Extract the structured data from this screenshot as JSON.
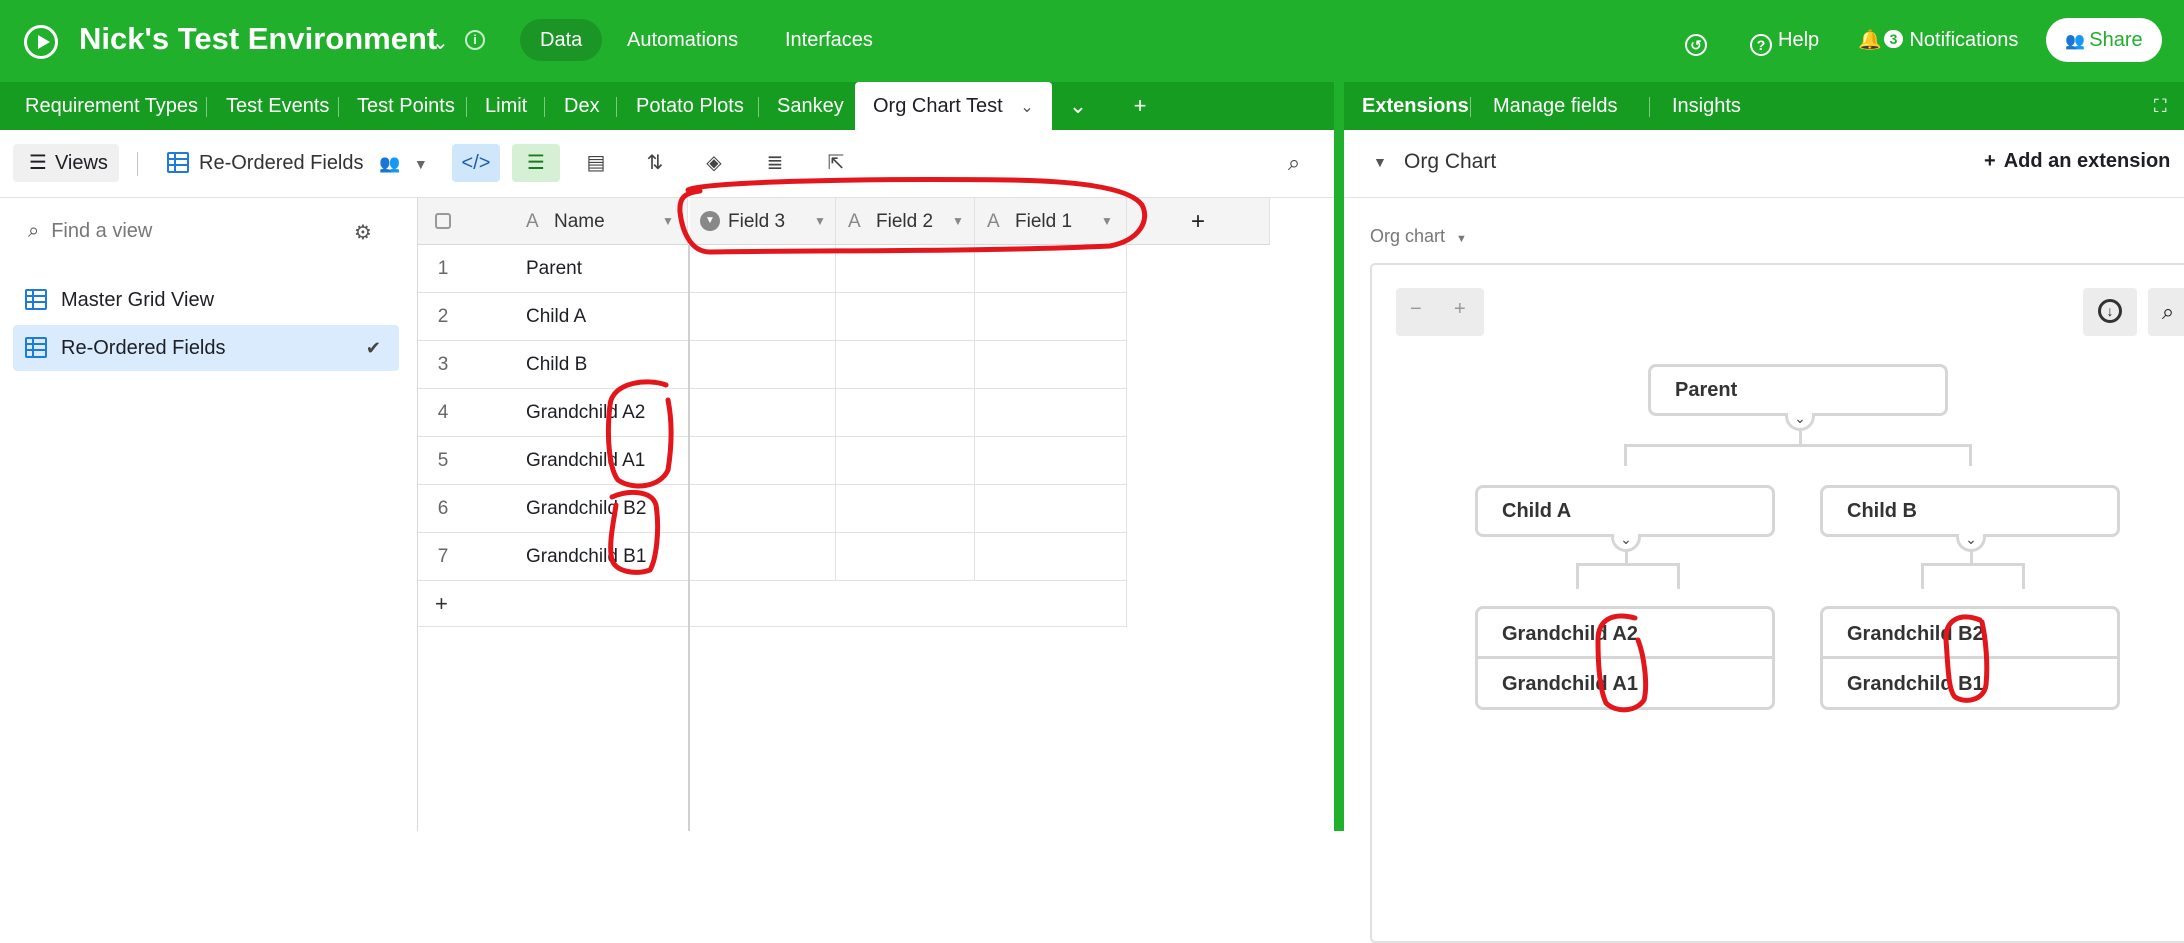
{
  "topbar": {
    "title": "Nick's Test Environment",
    "nav": [
      "Data",
      "Automations",
      "Interfaces"
    ],
    "help": "Help",
    "notifications": "Notifications",
    "notification_count": "3",
    "share": "Share"
  },
  "tabs": [
    "Requirement Types",
    "Test Events",
    "Test Points",
    "Limit",
    "Dex",
    "Potato Plots",
    "Sankey",
    "Org Chart Test"
  ],
  "ext_tabs": [
    "Extensions",
    "Manage fields",
    "Insights"
  ],
  "toolbar": {
    "views": "Views",
    "view_name": "Re-Ordered Fields"
  },
  "sidebar": {
    "find_placeholder": "Find a view",
    "views": [
      "Master Grid View",
      "Re-Ordered Fields"
    ]
  },
  "grid": {
    "columns": [
      "Name",
      "Field 3",
      "Field 2",
      "Field 1"
    ],
    "rows": [
      {
        "num": "1",
        "name": "Parent"
      },
      {
        "num": "2",
        "name": "Child A"
      },
      {
        "num": "3",
        "name": "Child B"
      },
      {
        "num": "4",
        "name": "Grandchild A2"
      },
      {
        "num": "5",
        "name": "Grandchild A1"
      },
      {
        "num": "6",
        "name": "Grandchild B2"
      },
      {
        "num": "7",
        "name": "Grandchild B1"
      }
    ],
    "add_row": "+"
  },
  "extension": {
    "header": "Org Chart",
    "add_extension": "Add an extension",
    "chart_label": "Org chart",
    "zoom_out": "−",
    "zoom_in": "+",
    "nodes": {
      "root": "Parent",
      "child_a": "Child A",
      "child_b": "Child B",
      "gc_a2": "Grandchild A2",
      "gc_a1": "Grandchild A1",
      "gc_b2": "Grandchild B2",
      "gc_b1": "Grandchild B1"
    }
  },
  "colors": {
    "brand": "#20b02c",
    "tab_bar": "#169c20",
    "annotation": "#e3161c",
    "selected_view": "#d9ebfc"
  }
}
